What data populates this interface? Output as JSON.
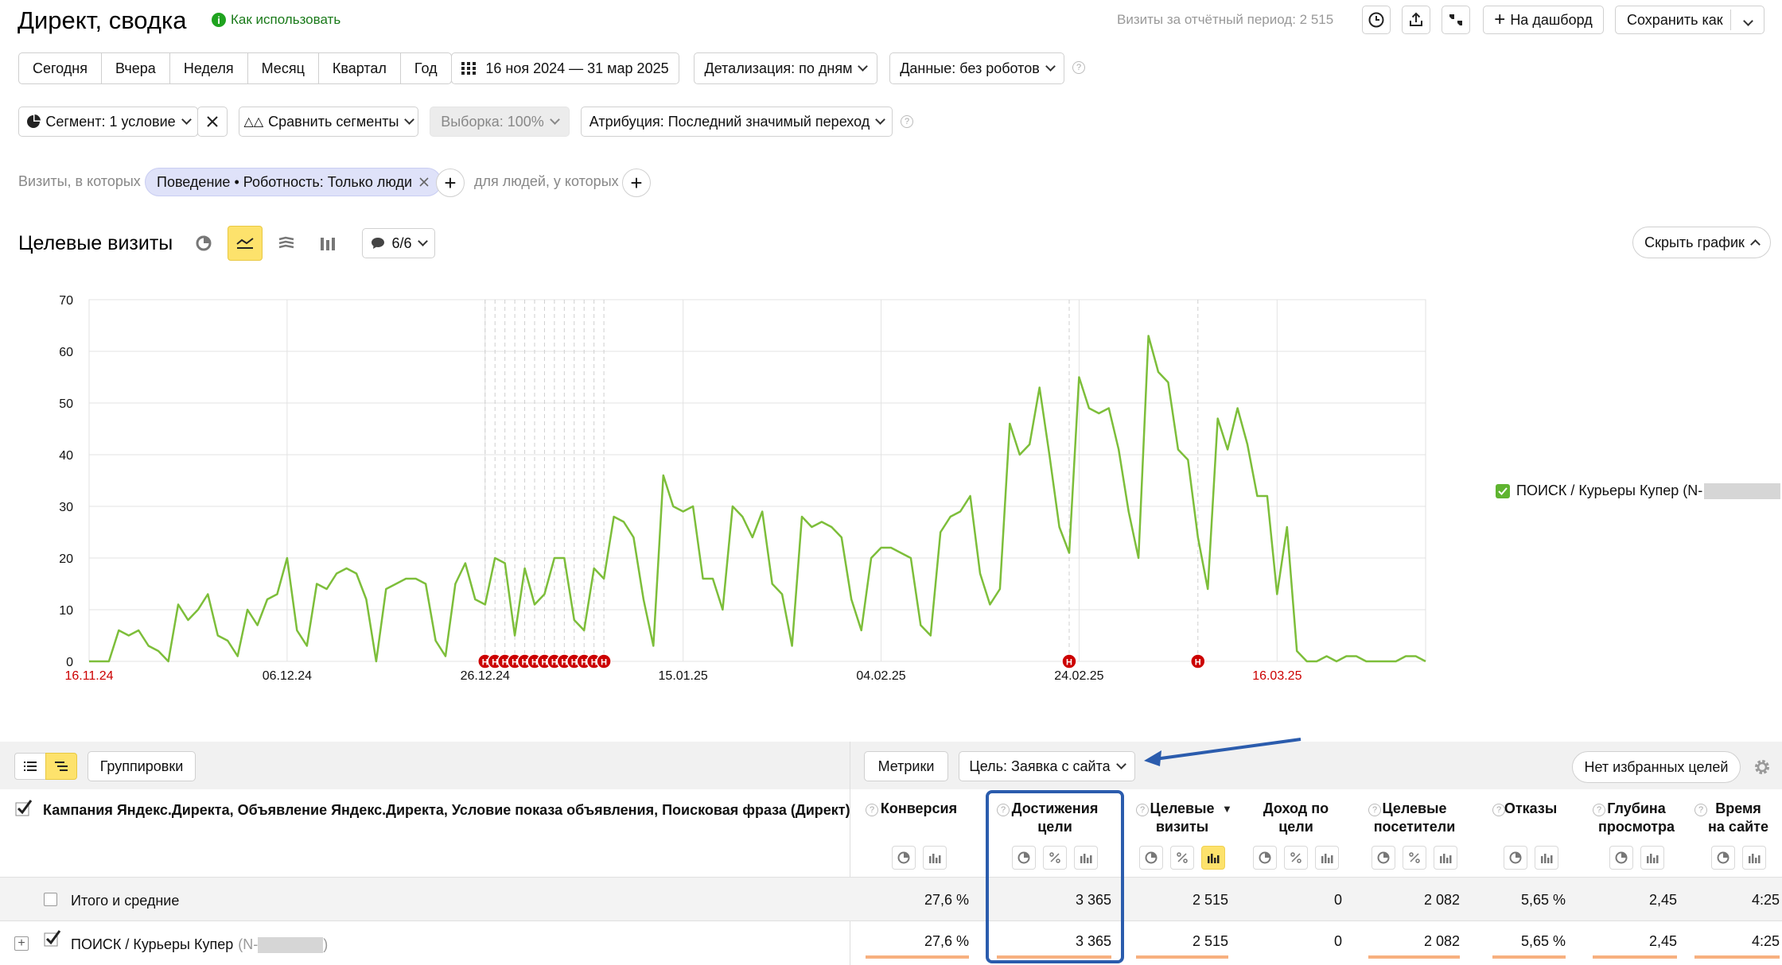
{
  "header": {
    "title": "Директ, сводка",
    "help_link": "Как использовать",
    "visits_label": "Визиты за отчётный период: 2 515",
    "to_dashboard": "На дашборд",
    "save_as": "Сохранить как"
  },
  "periods": [
    "Сегодня",
    "Вчера",
    "Неделя",
    "Месяц",
    "Квартал",
    "Год"
  ],
  "date_range": "16 ноя 2024 — 31 мар 2025",
  "detail": "Детализация: по дням",
  "data_filter": "Данные: без роботов",
  "segment": "Сегмент: 1 условие",
  "compare": "Сравнить сегменты",
  "sample": "Выборка: 100%",
  "attribution": "Атрибуция: Последний значимый переход",
  "filter": {
    "visits_prefix": "Визиты, в которых",
    "chip": "Поведение • Роботность: Только люди",
    "people_label": "для людей, у которых"
  },
  "chart_header": {
    "title": "Целевые визиты",
    "notes": "6/6",
    "hide": "Скрыть график"
  },
  "colors": {
    "line": "#7dbe3a",
    "accent_blue": "#2b5cad",
    "marker_red": "#cc0000",
    "yellow": "#fde26c"
  },
  "chart_data": {
    "type": "line",
    "ylim": [
      0,
      70
    ],
    "yticks": [
      "70",
      "60",
      "50",
      "40",
      "30",
      "20",
      "10",
      "0"
    ],
    "xticks": [
      {
        "label": "16.11.24",
        "day": 0,
        "red": true
      },
      {
        "label": "06.12.24",
        "day": 20,
        "red": false
      },
      {
        "label": "26.12.24",
        "day": 40,
        "red": false
      },
      {
        "label": "15.01.25",
        "day": 60,
        "red": false
      },
      {
        "label": "04.02.25",
        "day": 80,
        "red": false
      },
      {
        "label": "24.02.25",
        "day": 100,
        "red": false
      },
      {
        "label": "16.03.25",
        "day": 120,
        "red": true
      }
    ],
    "series": [
      {
        "name": "ПОИСК / Курьеры Купер (N-",
        "values": [
          0,
          0,
          0,
          6,
          5,
          6,
          3,
          2,
          0,
          11,
          8,
          10,
          13,
          5,
          4,
          1,
          10,
          7,
          12,
          13,
          20,
          6,
          3,
          15,
          14,
          17,
          18,
          17,
          12,
          0,
          14,
          15,
          16,
          16,
          15,
          4,
          1,
          15,
          19,
          12,
          11,
          20,
          19,
          5,
          18,
          11,
          13,
          20,
          20,
          8,
          6,
          18,
          16,
          28,
          27,
          24,
          12,
          3,
          36,
          30,
          29,
          30,
          16,
          16,
          10,
          30,
          28,
          24,
          29,
          15,
          13,
          3,
          28,
          26,
          27,
          26,
          24,
          12,
          6,
          20,
          22,
          22,
          21,
          20,
          7,
          5,
          25,
          28,
          29,
          32,
          17,
          11,
          14,
          46,
          40,
          42,
          53,
          40,
          26,
          21,
          55,
          49,
          48,
          49,
          41,
          29,
          20,
          63,
          56,
          54,
          41,
          39,
          24,
          14,
          47,
          41,
          49,
          42,
          32,
          32,
          13,
          26,
          2,
          0,
          0,
          1,
          0,
          1,
          1,
          0,
          0,
          0,
          0,
          1,
          1,
          0
        ]
      }
    ],
    "markers": [
      40,
      41,
      42,
      43,
      44,
      45,
      46,
      47,
      48,
      49,
      50,
      51,
      52,
      99,
      112
    ],
    "marker_label": "Н"
  },
  "table_toolbar": {
    "groupings": "Группировки",
    "metrics": "Метрики",
    "goal": "Цель: Заявка с сайта",
    "favorites": "Нет избранных целей"
  },
  "table": {
    "dim_header": "Кампания Яндекс.Директа, Объявление Яндекс.Директа, Условие показа объявления, Поисковая фраза (Директ)",
    "columns": [
      {
        "line1": "Конверсия",
        "line2": ""
      },
      {
        "line1": "Достижения",
        "line2": "цели"
      },
      {
        "line1": "Целевые",
        "line2": "визиты"
      },
      {
        "line1": "Доход по",
        "line2": "цели"
      },
      {
        "line1": "Целевые",
        "line2": "посетители"
      },
      {
        "line1": "Отказы",
        "line2": ""
      },
      {
        "line1": "Глубина",
        "line2": "просмотра"
      },
      {
        "line1": "Время",
        "line2": "на сайте"
      }
    ],
    "totals_label": "Итого и средние",
    "totals": [
      "27,6 %",
      "3 365",
      "2 515",
      "0",
      "2 082",
      "5,65 %",
      "2,45",
      "4:25"
    ],
    "row_label": "ПОИСК / Курьеры Купер",
    "row_suffix": "(N-",
    "row": [
      "27,6 %",
      "3 365",
      "2 515",
      "0",
      "2 082",
      "5,65 %",
      "2,45",
      "4:25"
    ]
  }
}
